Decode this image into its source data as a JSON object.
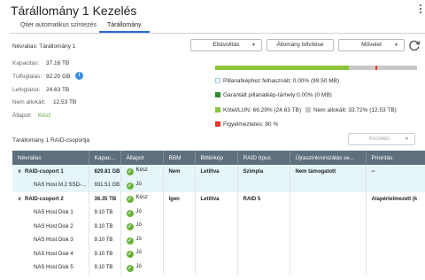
{
  "window": {
    "title": "Tárállomány 1 Kezelés"
  },
  "tabs": [
    "Qtier automatikus szintezés",
    "Tárállomány"
  ],
  "alias": "Név/alias: Tárállomány 1",
  "info_fields": [
    {
      "label": "Kapacitás:",
      "value": "37.16 TB"
    },
    {
      "label": "Túlfoglalás:",
      "value": "92.20 GB"
    },
    {
      "label": "Lefoglalva:",
      "value": "24.63 TB"
    },
    {
      "label": "Nem allokált:",
      "value": "12.53 TB"
    },
    {
      "label": "Állapot:",
      "value": "Kész"
    }
  ],
  "buttons": {
    "remove": "Eltávolítás",
    "expand": "Állomány bővítése",
    "action": "Művelet"
  },
  "usage_bar": {
    "used_fraction": 0.6629,
    "warning_fraction": 0.8
  },
  "legend": {
    "snapshot_used": "Pillanatképhez felhasznált: 0.00% (99.50 MB)",
    "snapshot_reserved": "Garantált pillanatkép-tárhely:0.00% (0 MB)",
    "volume_lun": "Kötet/LUN: 66.29% (24.63 TB)",
    "unallocated": "Nem allokált: 33.72% (12.53 TB)",
    "threshold": "Figyelmeztetés: 80 %"
  },
  "colors": {
    "used": "#8cc43c",
    "reserved": "#2e8b2e",
    "threshold": "#e8372c",
    "unallocated": "#c8c8c8",
    "accent": "#2a6ad2"
  },
  "raid_section": {
    "title": "Tárállomány 1 RAID-csoportja",
    "manage_button": "Kezelés"
  },
  "table": {
    "columns": [
      "Név/alias",
      "Kapac...",
      "Állapot",
      "BBM",
      "Bittérkép",
      "RAID típus",
      "Újraszinkronizálás se...",
      "Prioritás"
    ],
    "rows": [
      {
        "name": "RAID-csoport 1",
        "capacity": "829.81 GB",
        "status": "Kész",
        "bbm": "Nem",
        "bitmap": "Letiltva",
        "raid": "Szimpla",
        "resync": "Nem támogatott",
        "priority": "--",
        "type": "group"
      },
      {
        "name": "NAS Host M.2 SSD-...",
        "capacity": "931.51 GB",
        "status": "Jó",
        "bbm": "",
        "bitmap": "",
        "raid": "",
        "resync": "",
        "priority": "",
        "type": "disk"
      },
      {
        "name": "RAID-csoport 2",
        "capacity": "36.35 TB",
        "status": "Kész",
        "bbm": "Igen",
        "bitmap": "Letiltva",
        "raid": "RAID 5",
        "resync": "",
        "priority": "Alapértelmezett (k",
        "type": "group"
      },
      {
        "name": "NAS Host Disk 1",
        "capacity": "9.10 TB",
        "status": "Jó",
        "bbm": "",
        "bitmap": "",
        "raid": "",
        "resync": "",
        "priority": "",
        "type": "disk"
      },
      {
        "name": "NAS Host Disk 2",
        "capacity": "9.10 TB",
        "status": "Jó",
        "bbm": "",
        "bitmap": "",
        "raid": "",
        "resync": "",
        "priority": "",
        "type": "disk"
      },
      {
        "name": "NAS Host Disk 3",
        "capacity": "9.10 TB",
        "status": "Jó",
        "bbm": "",
        "bitmap": "",
        "raid": "",
        "resync": "",
        "priority": "",
        "type": "disk"
      },
      {
        "name": "NAS Host Disk 4",
        "capacity": "9.10 TB",
        "status": "Jó",
        "bbm": "",
        "bitmap": "",
        "raid": "",
        "resync": "",
        "priority": "",
        "type": "disk"
      },
      {
        "name": "NAS Host Disk 5",
        "capacity": "9.10 TB",
        "status": "Jó",
        "bbm": "",
        "bitmap": "",
        "raid": "",
        "resync": "",
        "priority": "",
        "type": "disk"
      }
    ]
  }
}
